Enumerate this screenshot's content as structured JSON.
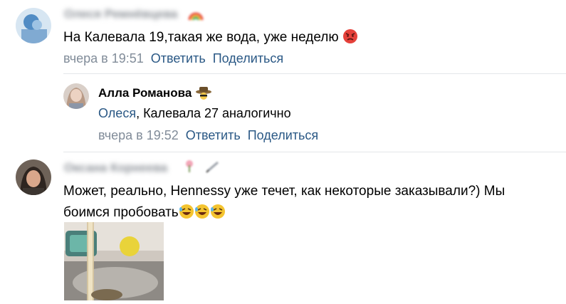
{
  "comments": [
    {
      "author": "Олеся Ремнёвцева",
      "author_emoji": "rainbow-emoji",
      "text": "На Калевала 19,такая же вода, уже неделю",
      "text_emoji": "angry-face-emoji",
      "time": "вчера в 19:51",
      "reply_label": "Ответить",
      "share_label": "Поделиться",
      "reply": {
        "author": "Алла Романова",
        "author_emoji": "detective-hat-emoji",
        "mention": "Олеся",
        "text": ", Калевала 27 аналогично",
        "time": "вчера в 19:52",
        "reply_label": "Ответить",
        "share_label": "Поделиться"
      }
    },
    {
      "author": "Оксана Корнеева",
      "author_emoji": "flower-pen-emoji",
      "text_line1": "Может, реально, Hennessy уже течет, как некоторые заказывали?) Мы",
      "text_line2": "боимся пробовать",
      "text_emoji": "rolling-laughing-emoji",
      "text_emoji_count": 3,
      "photo": "photo-kitchen-sink-water"
    }
  ],
  "colors": {
    "link": "#2a5885",
    "meta_gray": "#818c99",
    "divider": "#e4e6e9"
  }
}
